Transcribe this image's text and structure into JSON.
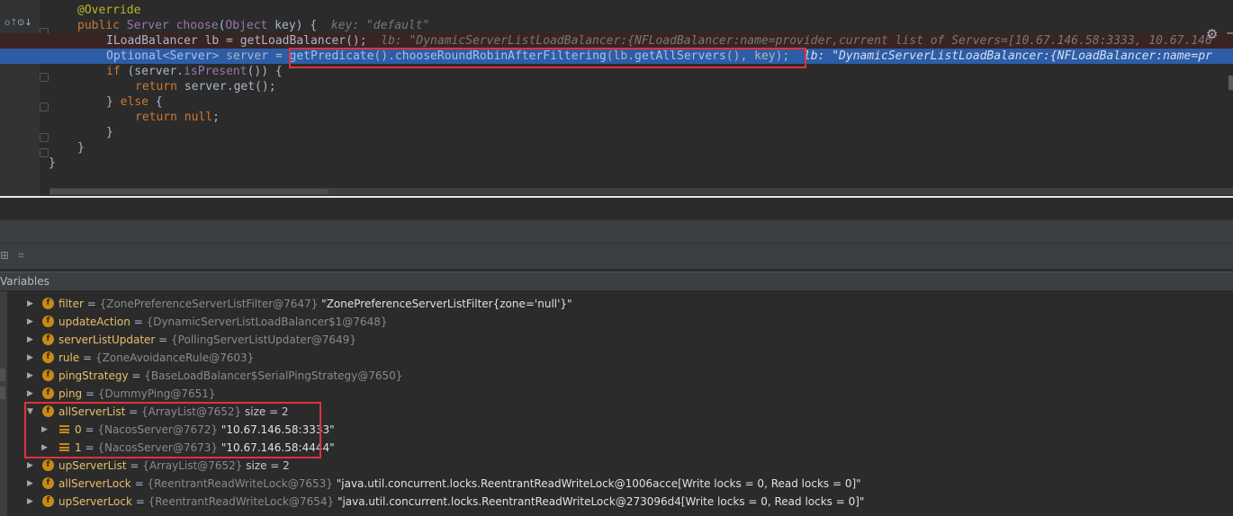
{
  "editor": {
    "lines": {
      "override": "@Override",
      "sig_kw": "public",
      "sig_type": "Server",
      "sig_fn": "choose",
      "sig_open": "(",
      "sig_param_type": "Object",
      "sig_param": " key) {",
      "sig_hint_label": "key: ",
      "sig_hint_value": "\"default\"",
      "lb_code": "ILoadBalancer lb = getLoadBalancer();",
      "lb_hint": "lb: \"DynamicServerListLoadBalancer:{NFLoadBalancer:name=provider,current list of Servers=[10.67.146.58:3333, 10.67.146",
      "exec_prefix1": "Optional",
      "exec_prefix2": "<",
      "exec_prefix3": "Server",
      "exec_prefix4": "> server = ",
      "exec_m1": "getPredicate",
      "exec_m2": "().",
      "exec_m3": "chooseRoundRobinAfterFiltering",
      "exec_m4": "(lb.",
      "exec_m5": "getAllServers",
      "exec_m6": "(), key);",
      "exec_hint": "lb: \"DynamicServerListLoadBalancer:{NFLoadBalancer:name=pr",
      "if_kw": "if",
      "if_open": " (server.",
      "if_fn": "isPresent",
      "if_rest": "()) {",
      "ret1_kw": "return",
      "ret1_code": " server.get();",
      "else_close": "} ",
      "else_kw": "else",
      "else_rest": " {",
      "ret2_kw": "return",
      "ret2_null": " null",
      "ret2_semi": ";",
      "close_inner": "}",
      "close_method": "}",
      "close_class": "}"
    }
  },
  "debug": {
    "panel_title": "Variables",
    "rows": [
      {
        "arrow": "▶",
        "name": "filter",
        "type": "{ZonePreferenceServerListFilter@7647}",
        "value": "\"ZonePreferenceServerListFilter{zone='null'}\""
      },
      {
        "arrow": "▶",
        "name": "updateAction",
        "type": "{DynamicServerListLoadBalancer$1@7648}",
        "value": ""
      },
      {
        "arrow": "▶",
        "name": "serverListUpdater",
        "type": "{PollingServerListUpdater@7649}",
        "value": ""
      },
      {
        "arrow": "▶",
        "name": "rule",
        "type": "{ZoneAvoidanceRule@7603}",
        "value": ""
      },
      {
        "arrow": "▶",
        "name": "pingStrategy",
        "type": "{BaseLoadBalancer$SerialPingStrategy@7650}",
        "value": ""
      },
      {
        "arrow": "▶",
        "name": "ping",
        "type": "{DummyPing@7651}",
        "value": ""
      },
      {
        "arrow": "▼",
        "name": "allServerList",
        "type": "{ArrayList@7652}",
        "value": "size = 2"
      },
      {
        "arrow": "▶",
        "name": "0",
        "type": "{NacosServer@7672}",
        "value": "\"10.67.146.58:3333\""
      },
      {
        "arrow": "▶",
        "name": "1",
        "type": "{NacosServer@7673}",
        "value": "\"10.67.146.58:4444\""
      },
      {
        "arrow": "▶",
        "name": "upServerList",
        "type": "{ArrayList@7652}",
        "value": "size = 2"
      },
      {
        "arrow": "▶",
        "name": "allServerLock",
        "type": "{ReentrantReadWriteLock@7653}",
        "value": "\"java.util.concurrent.locks.ReentrantReadWriteLock@1006acce[Write locks = 0, Read locks = 0]\""
      },
      {
        "arrow": "▶",
        "name": "upServerLock",
        "type": "{ReentrantReadWriteLock@7654}",
        "value": "\"java.util.concurrent.locks.ReentrantReadWriteLock@273096d4[Write locks = 0, Read locks = 0]\""
      }
    ],
    "badge_letter": "f",
    "equals": " = "
  },
  "icons": {
    "gear": "⚙",
    "minus": "−",
    "restore": "⊞",
    "layout": "⌗"
  },
  "colors": {
    "editor_bg": "#2b2b2b",
    "exec_line": "#2d5da6",
    "highlight_box": "#e0323b",
    "field_badge": "#c88a18"
  }
}
